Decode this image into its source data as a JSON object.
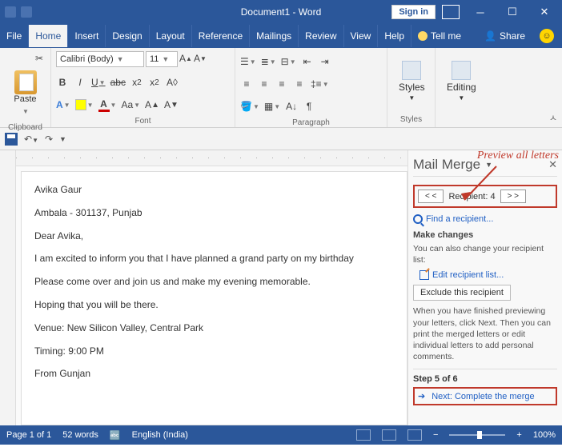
{
  "title": "Document1 - Word",
  "signin": "Sign in",
  "tabs": {
    "file": "File",
    "home": "Home",
    "insert": "Insert",
    "design": "Design",
    "layout": "Layout",
    "reference": "Reference",
    "mailings": "Mailings",
    "review": "Review",
    "view": "View",
    "help": "Help",
    "tellme": "Tell me",
    "share": "Share"
  },
  "ribbon": {
    "clipboard": {
      "paste": "Paste",
      "label": "Clipboard"
    },
    "font": {
      "name": "Calibri (Body)",
      "size": "11",
      "label": "Font"
    },
    "paragraph": {
      "label": "Paragraph"
    },
    "styles": {
      "btn": "Styles",
      "label": "Styles"
    },
    "editing": {
      "btn": "Editing"
    }
  },
  "doc": {
    "p1": "Avika Gaur",
    "p2": "Ambala - 301137, Punjab",
    "p3": "Dear Avika,",
    "p4": "I am excited to inform you that I have planned a grand party on my birthday",
    "p5": "Please come over and join us and make my evening memorable.",
    "p6": "Hoping that you will be there.",
    "p7": "Venue: New Silicon Valley, Central Park",
    "p8": "Timing: 9:00 PM",
    "p9": "From Gunjan"
  },
  "pane": {
    "title": "Mail Merge",
    "prev": "< <",
    "recipient": "Recipient: 4",
    "next": "> >",
    "find": "Find a recipient...",
    "make_changes": "Make changes",
    "change_note": "You can also change your recipient list:",
    "edit_list": "Edit recipient list...",
    "exclude": "Exclude this recipient",
    "instr": "When you have finished previewing your letters, click Next. Then you can print the merged letters or edit individual letters to add personal comments.",
    "step": "Step 5 of 6",
    "next_step": "Next: Complete the merge"
  },
  "annot": "Preview all letters",
  "status": {
    "page": "Page 1 of 1",
    "words": "52 words",
    "lang": "English (India)",
    "zoom": "100%"
  }
}
